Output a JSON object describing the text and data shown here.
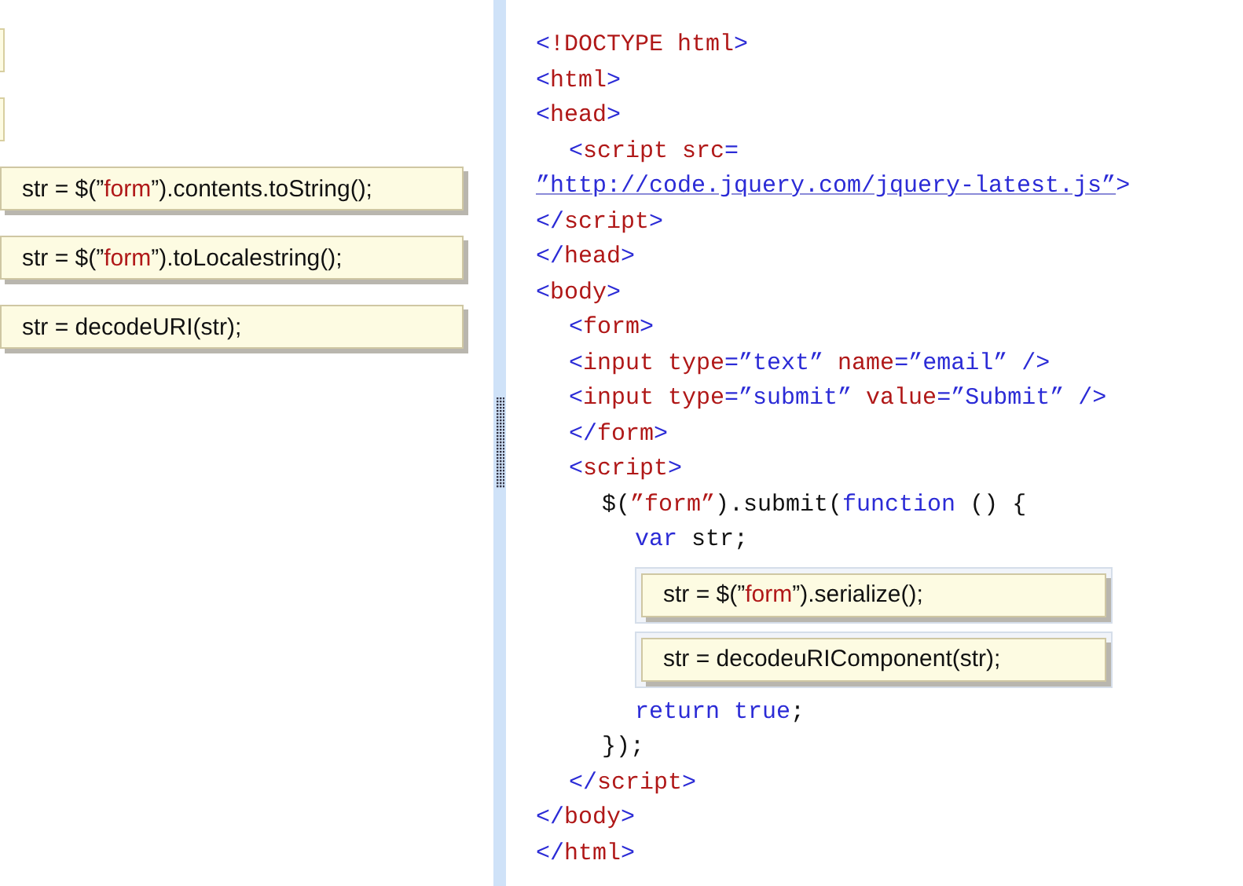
{
  "answer_tiles": [
    {
      "kind": "empty"
    },
    {
      "kind": "empty"
    },
    {
      "kind": "tile",
      "parts": [
        {
          "text": "str = $(”",
          "kind": "plain"
        },
        {
          "text": "form",
          "kind": "string"
        },
        {
          "text": "”).contents.toString();",
          "kind": "plain"
        }
      ]
    },
    {
      "kind": "tile",
      "parts": [
        {
          "text": "str = $(”",
          "kind": "plain"
        },
        {
          "text": "form",
          "kind": "string"
        },
        {
          "text": "”).toLocalestring();",
          "kind": "plain"
        }
      ]
    },
    {
      "kind": "tile",
      "parts": [
        {
          "text": "str = decodeURI(str);",
          "kind": "plain"
        }
      ]
    }
  ],
  "code": [
    {
      "kind": "line",
      "parts": [
        {
          "text": "<",
          "kind": "punct"
        },
        {
          "text": "!DOCTYPE html",
          "kind": "tag"
        },
        {
          "text": ">",
          "kind": "punct"
        }
      ]
    },
    {
      "kind": "line",
      "parts": [
        {
          "text": "<",
          "kind": "punct"
        },
        {
          "text": "html",
          "kind": "tag"
        },
        {
          "text": ">",
          "kind": "punct"
        }
      ]
    },
    {
      "kind": "line",
      "parts": [
        {
          "text": "<",
          "kind": "punct"
        },
        {
          "text": "head",
          "kind": "tag"
        },
        {
          "text": ">",
          "kind": "punct"
        }
      ],
      "children": [
        {
          "kind": "line",
          "parts": [
            {
              "text": "<",
              "kind": "punct"
            },
            {
              "text": "script src",
              "kind": "tag"
            },
            {
              "text": "=",
              "kind": "punct"
            }
          ]
        }
      ]
    },
    {
      "kind": "line",
      "parts": [
        {
          "text": "”http://code.jquery.com/jquery-latest.js”",
          "kind": "link"
        },
        {
          "text": ">",
          "kind": "punct"
        }
      ]
    },
    {
      "kind": "line",
      "parts": [
        {
          "text": "</",
          "kind": "punct"
        },
        {
          "text": "script",
          "kind": "tag"
        },
        {
          "text": ">",
          "kind": "punct"
        }
      ]
    },
    {
      "kind": "line",
      "parts": [
        {
          "text": "</",
          "kind": "punct"
        },
        {
          "text": "head",
          "kind": "tag"
        },
        {
          "text": ">",
          "kind": "punct"
        }
      ]
    },
    {
      "kind": "line",
      "parts": [
        {
          "text": "<",
          "kind": "punct"
        },
        {
          "text": "body",
          "kind": "tag"
        },
        {
          "text": ">",
          "kind": "punct"
        }
      ],
      "children": [
        {
          "kind": "line",
          "parts": [
            {
              "text": "<",
              "kind": "punct"
            },
            {
              "text": "form",
              "kind": "tag"
            },
            {
              "text": ">",
              "kind": "punct"
            }
          ]
        },
        {
          "kind": "line",
          "parts": [
            {
              "text": "<",
              "kind": "punct"
            },
            {
              "text": "input type",
              "kind": "tag"
            },
            {
              "text": "=”text”",
              "kind": "punct"
            },
            {
              "text": " name",
              "kind": "tag"
            },
            {
              "text": "=”email” />",
              "kind": "punct"
            }
          ]
        },
        {
          "kind": "line",
          "parts": [
            {
              "text": "<",
              "kind": "punct"
            },
            {
              "text": "input type",
              "kind": "tag"
            },
            {
              "text": "=”submit”",
              "kind": "punct"
            },
            {
              "text": " value",
              "kind": "tag"
            },
            {
              "text": "=”Submit” />",
              "kind": "punct"
            }
          ]
        },
        {
          "kind": "line",
          "parts": [
            {
              "text": "</",
              "kind": "punct"
            },
            {
              "text": "form",
              "kind": "tag"
            },
            {
              "text": ">",
              "kind": "punct"
            }
          ]
        },
        {
          "kind": "line",
          "parts": [
            {
              "text": "<",
              "kind": "punct"
            },
            {
              "text": "script",
              "kind": "tag"
            },
            {
              "text": ">",
              "kind": "punct"
            }
          ],
          "children": [
            {
              "kind": "line",
              "parts": [
                {
                  "text": "$(",
                  "kind": "plain"
                },
                {
                  "text": "”form”",
                  "kind": "tag"
                },
                {
                  "text": ").submit(",
                  "kind": "plain"
                },
                {
                  "text": "function",
                  "kind": "punct"
                },
                {
                  "text": " () {",
                  "kind": "plain"
                }
              ],
              "children": [
                {
                  "kind": "line",
                  "parts": [
                    {
                      "text": "var",
                      "kind": "punct"
                    },
                    {
                      "text": " str;",
                      "kind": "plain"
                    }
                  ]
                },
                {
                  "kind": "slot",
                  "parts": [
                    {
                      "text": "str = $(”",
                      "kind": "plain"
                    },
                    {
                      "text": "form",
                      "kind": "string"
                    },
                    {
                      "text": "”).serialize();",
                      "kind": "plain"
                    }
                  ]
                },
                {
                  "kind": "slot",
                  "parts": [
                    {
                      "text": "str = decodeuRIComponent(str);",
                      "kind": "plain"
                    }
                  ]
                },
                {
                  "kind": "line",
                  "parts": [
                    {
                      "text": "return true",
                      "kind": "punct"
                    },
                    {
                      "text": ";",
                      "kind": "plain"
                    }
                  ]
                }
              ]
            },
            {
              "kind": "line",
              "parts": [
                {
                  "text": "});",
                  "kind": "plain"
                }
              ]
            }
          ]
        },
        {
          "kind": "line",
          "parts": [
            {
              "text": "</",
              "kind": "punct"
            },
            {
              "text": "script",
              "kind": "tag"
            },
            {
              "text": ">",
              "kind": "punct"
            }
          ]
        }
      ]
    },
    {
      "kind": "line",
      "parts": [
        {
          "text": "</",
          "kind": "punct"
        },
        {
          "text": "body",
          "kind": "tag"
        },
        {
          "text": ">",
          "kind": "punct"
        }
      ]
    },
    {
      "kind": "line",
      "parts": [
        {
          "text": "</",
          "kind": "punct"
        },
        {
          "text": "html",
          "kind": "tag"
        },
        {
          "text": ">",
          "kind": "punct"
        }
      ]
    }
  ]
}
